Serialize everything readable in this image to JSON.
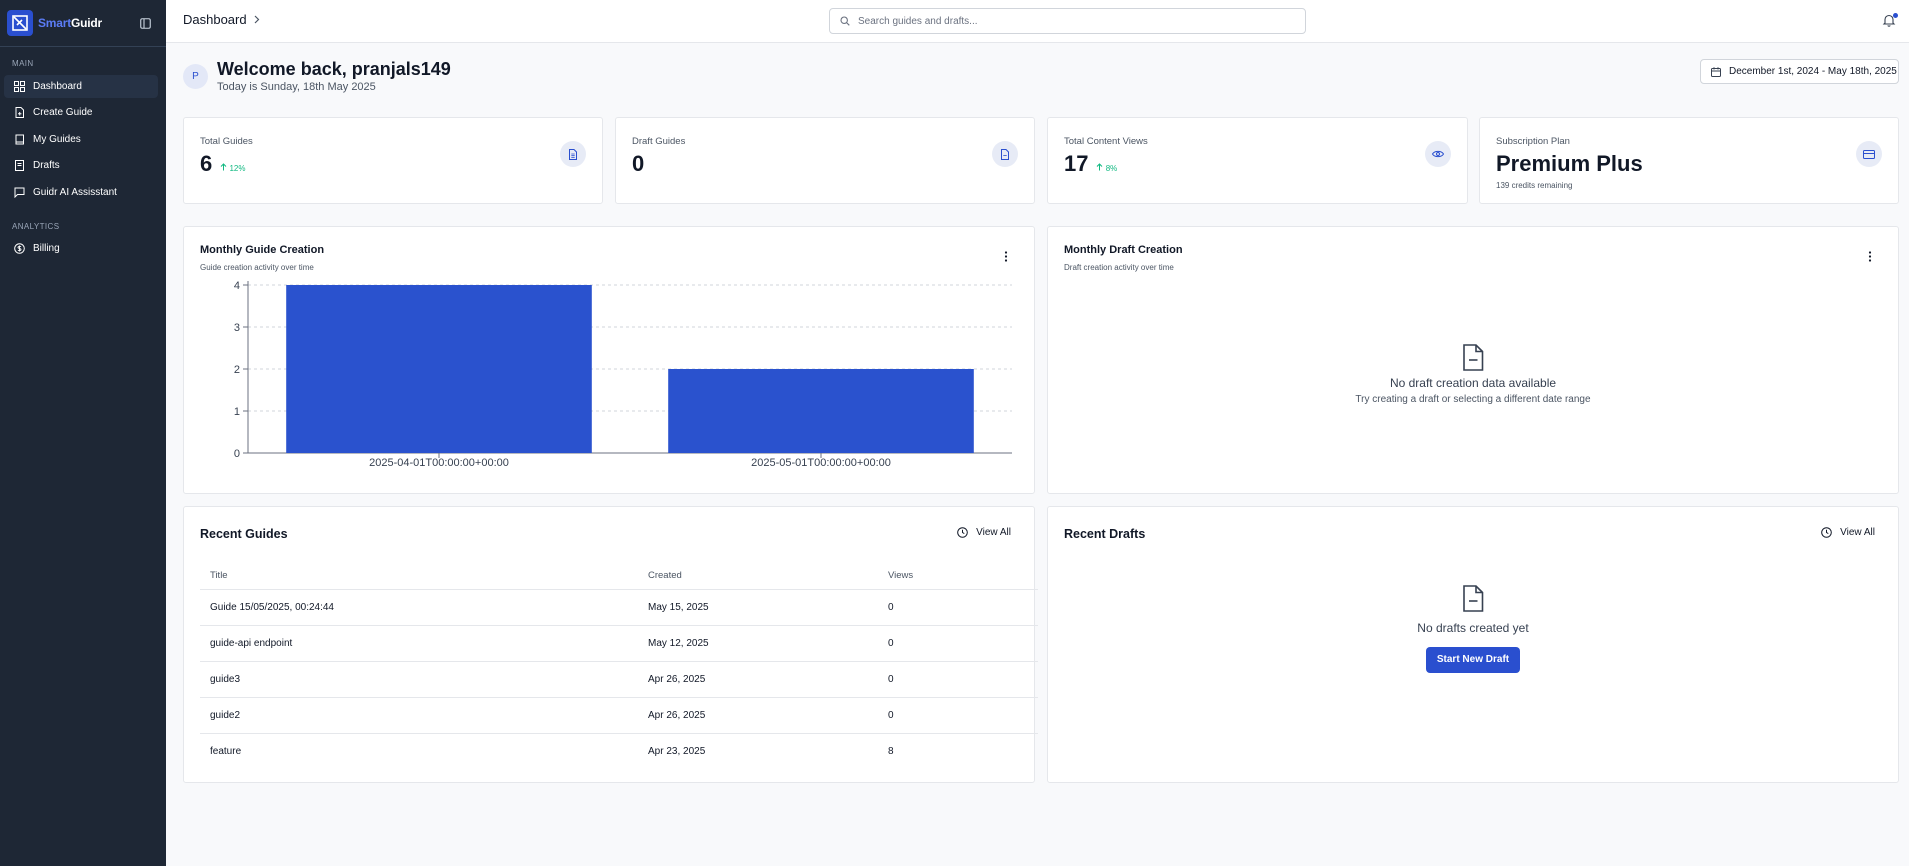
{
  "brand": {
    "name_part1": "Smart",
    "name_part2": "Guidr"
  },
  "sidebar": {
    "sections": [
      "MAIN",
      "ANALYTICS"
    ],
    "items": [
      {
        "label": "Dashboard"
      },
      {
        "label": "Create Guide"
      },
      {
        "label": "My Guides"
      },
      {
        "label": "Drafts"
      },
      {
        "label": "Guidr AI Assisstant"
      },
      {
        "label": "Billing"
      }
    ]
  },
  "header": {
    "breadcrumb": "Dashboard",
    "search_placeholder": "Search guides and drafts..."
  },
  "welcome": {
    "avatar_initial": "P",
    "title": "Welcome back, pranjals149",
    "subtitle": "Today is Sunday, 18th May 2025",
    "date_range": "December 1st, 2024 - May 18th, 2025"
  },
  "stats": [
    {
      "label": "Total Guides",
      "value": "6",
      "change": "12%",
      "icon": "file-text-icon"
    },
    {
      "label": "Draft Guides",
      "value": "0",
      "change": "",
      "icon": "file-icon"
    },
    {
      "label": "Total Content Views",
      "value": "17",
      "change": "8%",
      "icon": "eye-icon"
    }
  ],
  "plan": {
    "label": "Subscription Plan",
    "value": "Premium Plus",
    "sub": "139 credits remaining",
    "icon": "credit-card-icon"
  },
  "guide_chart": {
    "title": "Monthly Guide Creation",
    "subtitle": "Guide creation activity over time"
  },
  "draft_chart": {
    "title": "Monthly Draft Creation",
    "subtitle": "Draft creation activity over time",
    "empty_title": "No draft creation data available",
    "empty_sub": "Try creating a draft or selecting a different date range"
  },
  "chart_data": {
    "type": "bar",
    "categories": [
      "2025-04-01T00:00:00+00:00",
      "2025-05-01T00:00:00+00:00"
    ],
    "values": [
      4,
      2
    ],
    "yticks": [
      "0",
      "1",
      "2",
      "3",
      "4"
    ],
    "ylim": [
      0,
      4
    ],
    "grid": true,
    "bar_color": "#2a52ce"
  },
  "recent_guides": {
    "title": "Recent Guides",
    "view_all": "View All",
    "columns": [
      "Title",
      "Created",
      "Views"
    ],
    "rows": [
      {
        "title": "Guide 15/05/2025, 00:24:44",
        "created": "May 15, 2025",
        "views": "0"
      },
      {
        "title": "guide-api endpoint",
        "created": "May 12, 2025",
        "views": "0"
      },
      {
        "title": "guide3",
        "created": "Apr 26, 2025",
        "views": "0"
      },
      {
        "title": "guide2",
        "created": "Apr 26, 2025",
        "views": "0"
      },
      {
        "title": "feature",
        "created": "Apr 23, 2025",
        "views": "8"
      }
    ]
  },
  "recent_drafts": {
    "title": "Recent Drafts",
    "view_all": "View All",
    "empty_title": "No drafts created yet",
    "button": "Start New Draft"
  },
  "colors": {
    "accent": "#2a4fcf",
    "sidebar_bg": "#1e2735",
    "positive": "#10b981"
  }
}
